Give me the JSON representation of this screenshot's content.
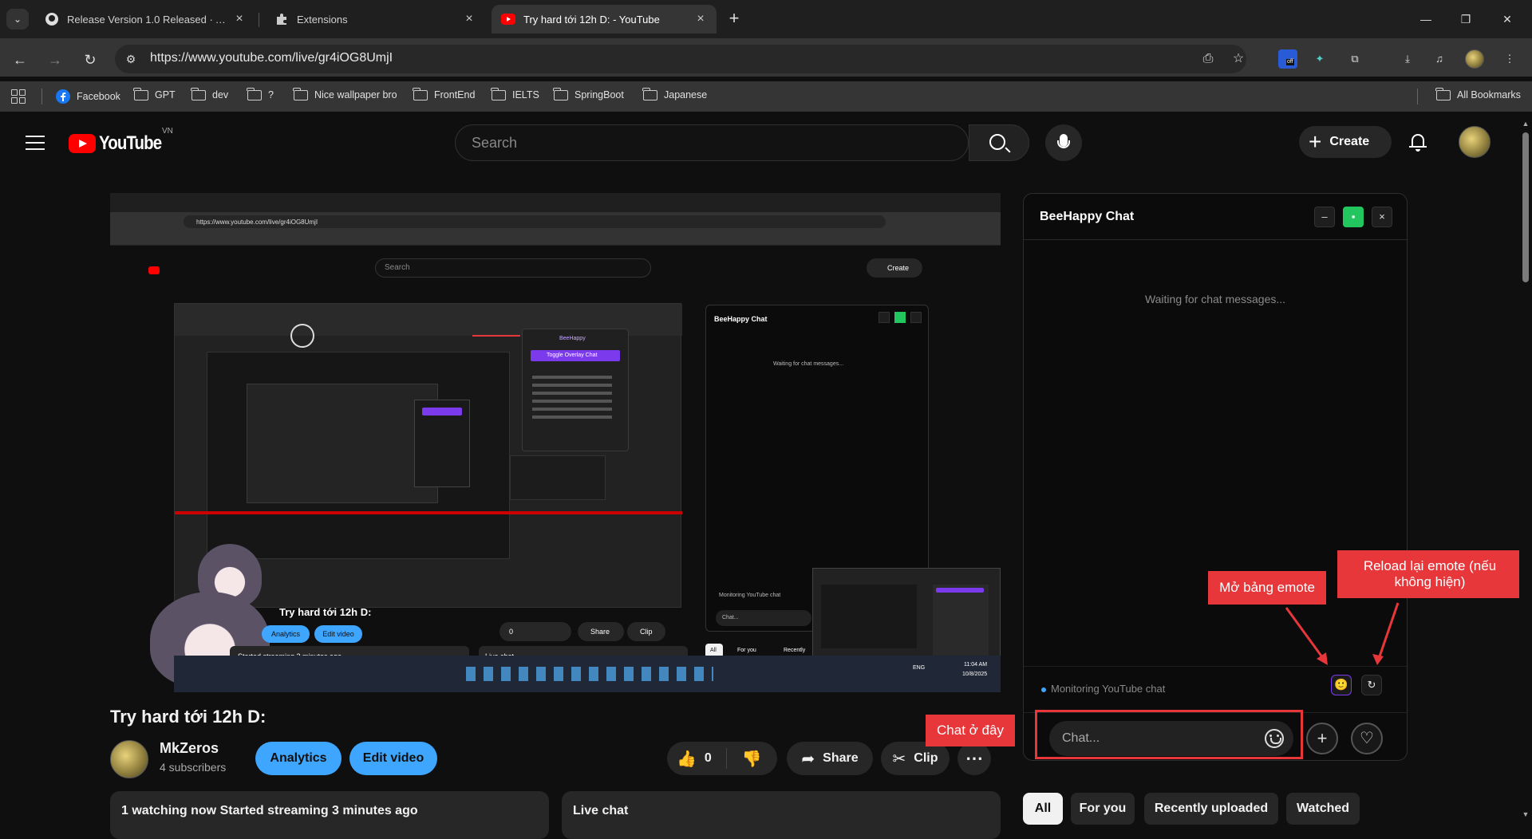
{
  "browser": {
    "tabs": [
      {
        "title": "Release Version 1.0 Released · AimKey"
      },
      {
        "title": "Extensions"
      },
      {
        "title": "Try hard tới 12h D: - YouTube"
      }
    ],
    "url": "https://www.youtube.com/live/gr4iOG8UmjI",
    "bookmarks": [
      "Facebook",
      "GPT",
      "dev",
      "?",
      "Nice wallpaper bro",
      "FrontEnd",
      "IELTS",
      "SpringBoot",
      "Japanese"
    ],
    "all_bookmarks": "All Bookmarks",
    "ext_off_badge": "off"
  },
  "youtube": {
    "logo_text": "YouTube",
    "country": "VN",
    "search_placeholder": "Search",
    "create_label": "Create"
  },
  "video": {
    "title": "Try hard tới 12h D:",
    "channel_name": "MkZeros",
    "subscribers": "4 subscribers",
    "analytics_label": "Analytics",
    "edit_label": "Edit video",
    "likes": "0",
    "share_label": "Share",
    "clip_label": "Clip",
    "watching": "1 watching now  Started streaming 3 minutes ago",
    "live_chat": "Live chat"
  },
  "video_frame": {
    "url": "https://www.youtube.com/live/gr4iOG8UmjI",
    "search": "Search",
    "create": "Create",
    "chat_title": "BeeHappy Chat",
    "waiting": "Waiting for chat messages...",
    "monitoring": "Monitoring YouTube chat",
    "chat_placeholder": "Chat...",
    "title": "Try hard tới 12h D:",
    "analytics": "Analytics",
    "edit": "Edit video",
    "started": "Started streaming 2 minutes ago",
    "live_chat": "Live chat",
    "chips": [
      "All",
      "For you",
      "Recently"
    ],
    "share": "Share",
    "clip": "Clip",
    "likes": "0",
    "popup_title": "BeeHappy",
    "popup_btn": "Toggle Overlay Chat",
    "time": "11:04 AM",
    "date": "10/8/2025",
    "lang": "ENG"
  },
  "chat": {
    "title": "BeeHappy Chat",
    "minimize": "–",
    "close": "×",
    "waiting": "Waiting for chat messages...",
    "status": "Monitoring YouTube chat",
    "input_placeholder": "Chat...",
    "emote_icon": "🙂",
    "reload_icon": "↻"
  },
  "chips": [
    "All",
    "For you",
    "Recently uploaded",
    "Watched"
  ],
  "annotations": {
    "emote": "Mở bảng emote",
    "reload": "Reload lại emote (nếu không hiện)",
    "chat": "Chat ở đây"
  },
  "colors": {
    "annotation_red": "#e8373a",
    "accent_blue": "#3ea6ff",
    "accent_purple": "#7c3aed",
    "status_green": "#22c55e"
  }
}
